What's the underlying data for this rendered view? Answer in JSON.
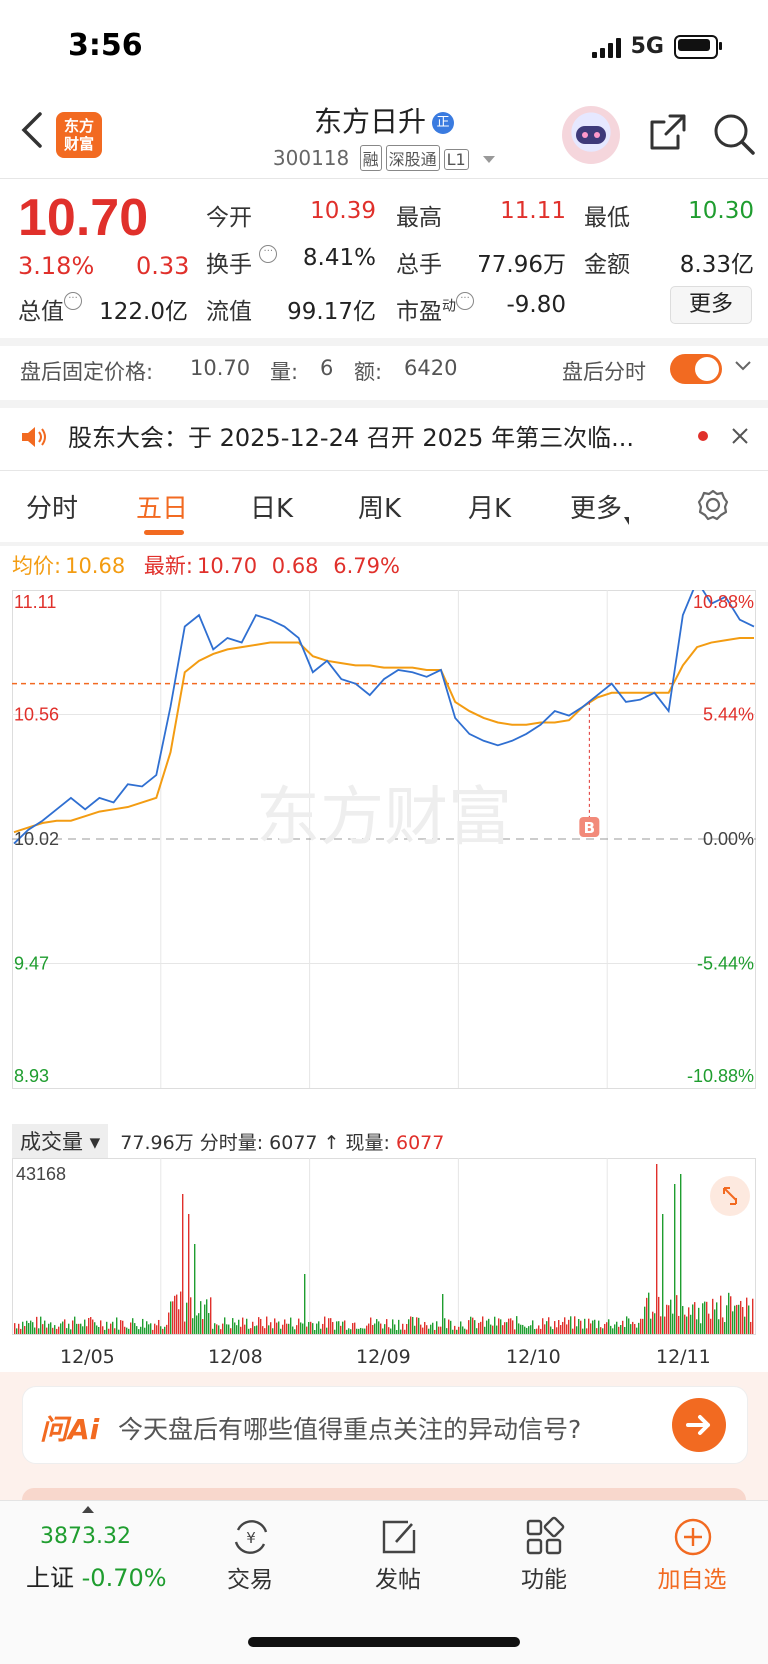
{
  "status": {
    "time": "3:56",
    "network": "5G"
  },
  "header": {
    "logo_text": "东方财富",
    "stock_name": "东方日升",
    "name_badge": "正",
    "code": "300118",
    "tags": [
      "融",
      "深股通",
      "L1"
    ]
  },
  "quote": {
    "price": "10.70",
    "pct": "3.18%",
    "change": "0.33",
    "rows": [
      [
        {
          "label": "今开",
          "value": "10.39",
          "color": "red"
        },
        {
          "label": "最高",
          "value": "11.11",
          "color": "red"
        },
        {
          "label": "最低",
          "value": "10.30",
          "color": "green"
        }
      ],
      [
        {
          "label": "换手",
          "value": "8.41%",
          "color": "dark"
        },
        {
          "label": "总手",
          "value": "77.96万",
          "color": "dark"
        },
        {
          "label": "金额",
          "value": "8.33亿",
          "color": "dark"
        }
      ],
      [
        {
          "label": "总值",
          "value": "122.0亿",
          "color": "dark"
        },
        {
          "label": "流值",
          "value": "99.17亿",
          "color": "dark"
        },
        {
          "label": "市盈",
          "value": "-9.80",
          "color": "dark"
        }
      ]
    ],
    "pe_sup": "动",
    "more": "更多"
  },
  "after_hours": {
    "label": "盘后固定价格:",
    "price": "10.70",
    "vol_label": "量:",
    "vol": "6",
    "amt_label": "额:",
    "amt": "6420",
    "toggle_label": "盘后分时",
    "toggle_on": true
  },
  "notice": {
    "text": "股东大会：于 2025-12-24 召开 2025 年第三次临..."
  },
  "tabs": [
    "分时",
    "五日",
    "日K",
    "周K",
    "月K",
    "更多"
  ],
  "active_tab": "五日",
  "avg_line": {
    "avg_label": "均价:",
    "avg": "10.68",
    "latest_label": "最新:",
    "latest": "10.70",
    "chg": "0.68",
    "pct": "6.79%"
  },
  "chart_data": {
    "type": "line",
    "title": "",
    "days": [
      "12/05",
      "12/08",
      "12/09",
      "12/10",
      "12/11"
    ],
    "prev_close": 10.02,
    "ylim": [
      8.93,
      11.11
    ],
    "y_ticks_left": [
      "11.11",
      "10.56",
      "10.02",
      "9.47",
      "8.93"
    ],
    "y_ticks_right": [
      "10.88%",
      "5.44%",
      "0.00%",
      "-5.44%",
      "-10.88%"
    ],
    "current_price_line": 10.7,
    "watermark": "东方财富",
    "marker": {
      "label": "B",
      "day": "12/10"
    },
    "series": [
      {
        "name": "价格",
        "color": "#2f6fd1",
        "values": [
          10.0,
          10.06,
          10.1,
          10.15,
          10.2,
          10.15,
          10.2,
          10.18,
          10.26,
          10.25,
          10.3,
          10.6,
          10.95,
          11.0,
          10.85,
          10.9,
          10.88,
          11.0,
          10.98,
          10.95,
          10.9,
          10.75,
          10.8,
          10.72,
          10.7,
          10.65,
          10.72,
          10.76,
          10.75,
          10.73,
          10.76,
          10.55,
          10.48,
          10.45,
          10.43,
          10.45,
          10.48,
          10.52,
          10.58,
          10.56,
          10.6,
          10.65,
          10.7,
          10.62,
          10.63,
          10.66,
          10.58,
          11.0,
          11.15,
          11.05,
          11.08,
          10.98,
          10.95
        ]
      },
      {
        "name": "均价",
        "color": "#f39c12",
        "values": [
          10.05,
          10.07,
          10.09,
          10.1,
          10.1,
          10.12,
          10.14,
          10.15,
          10.16,
          10.18,
          10.2,
          10.4,
          10.75,
          10.8,
          10.83,
          10.85,
          10.86,
          10.87,
          10.88,
          10.88,
          10.88,
          10.82,
          10.8,
          10.79,
          10.78,
          10.78,
          10.77,
          10.77,
          10.77,
          10.76,
          10.76,
          10.62,
          10.58,
          10.55,
          10.53,
          10.52,
          10.52,
          10.53,
          10.53,
          10.54,
          10.6,
          10.64,
          10.66,
          10.66,
          10.66,
          10.66,
          10.66,
          10.78,
          10.86,
          10.88,
          10.89,
          10.9,
          10.9
        ]
      }
    ]
  },
  "volume": {
    "selector": "成交量",
    "total": "77.96万",
    "tick_label": "分时量:",
    "tick": "6077",
    "now_label": "现量:",
    "now": "6077",
    "max": "43168",
    "arrow": "↑"
  },
  "ai": {
    "logo": "问Ai",
    "prompt": "今天盘后有哪些值得重点关注的异动信号?"
  },
  "nav": {
    "index_value": "3873.32",
    "index_name": "上证",
    "index_pct": "-0.70%",
    "items": [
      "交易",
      "发帖",
      "功能",
      "加自选"
    ]
  },
  "colors": {
    "up": "#e0302b",
    "down": "#1f9d2f",
    "accent": "#f26a21",
    "price_line": "#2f6fd1",
    "avg_line": "#f39c12"
  }
}
